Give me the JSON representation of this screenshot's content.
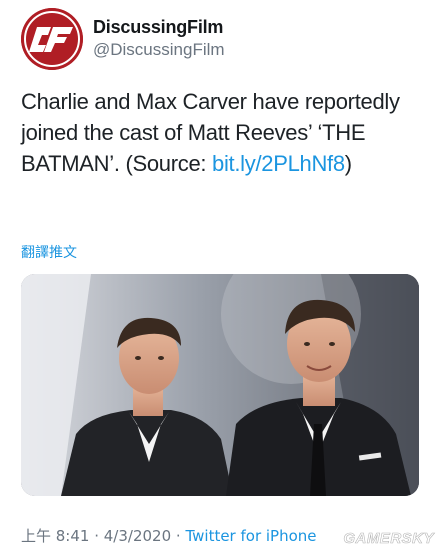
{
  "account": {
    "display_name": "DiscussingFilm",
    "handle": "@DiscussingFilm",
    "avatar_icon": "discussingfilm-logo-icon",
    "avatar_color": "#b01e25"
  },
  "tweet": {
    "text_before_link": "Charlie and Max Carver have reportedly joined the cast of Matt Reeves’ ‘THE BATMAN’. (Source: ",
    "link_text": "bit.ly/2PLhNf8",
    "text_after_link": ")",
    "translate_label": "翻譯推文",
    "photo_alt_icon": "photo-two-men-in-suits",
    "link_color": "#1b95e0"
  },
  "meta": {
    "time": "上午 8:41",
    "separator": " · ",
    "date": "4/3/2020",
    "source": "Twitter for iPhone"
  },
  "watermark": {
    "text": "GAMERSKY"
  }
}
